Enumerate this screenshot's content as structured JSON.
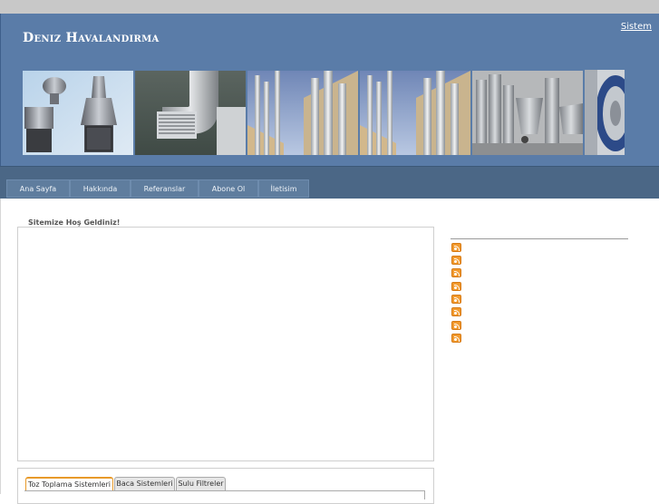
{
  "header": {
    "title": "Deniz Havalandırma",
    "top_link": "Sistem"
  },
  "nav": {
    "items": [
      {
        "label": "Ana Sayfa"
      },
      {
        "label": "Hakkında"
      },
      {
        "label": "Referanslar"
      },
      {
        "label": "Abone Ol"
      },
      {
        "label": "İletisim"
      }
    ]
  },
  "main": {
    "welcome_legend": "Sitemize Hoş Geldiniz!"
  },
  "tabs": [
    {
      "label": "Toz Toplama Sistemleri",
      "active": true
    },
    {
      "label": "Baca Sistemleri",
      "active": false
    },
    {
      "label": "Sulu Filtreler",
      "active": false
    }
  ],
  "sidebar": {
    "rss_icon_count": 8,
    "icon": "rss-icon"
  },
  "colors": {
    "header_bg": "#5a7ca8",
    "nav_bg": "#4b6786",
    "tab_active_accent": "#e89a2a",
    "rss": "#f29a2e"
  }
}
